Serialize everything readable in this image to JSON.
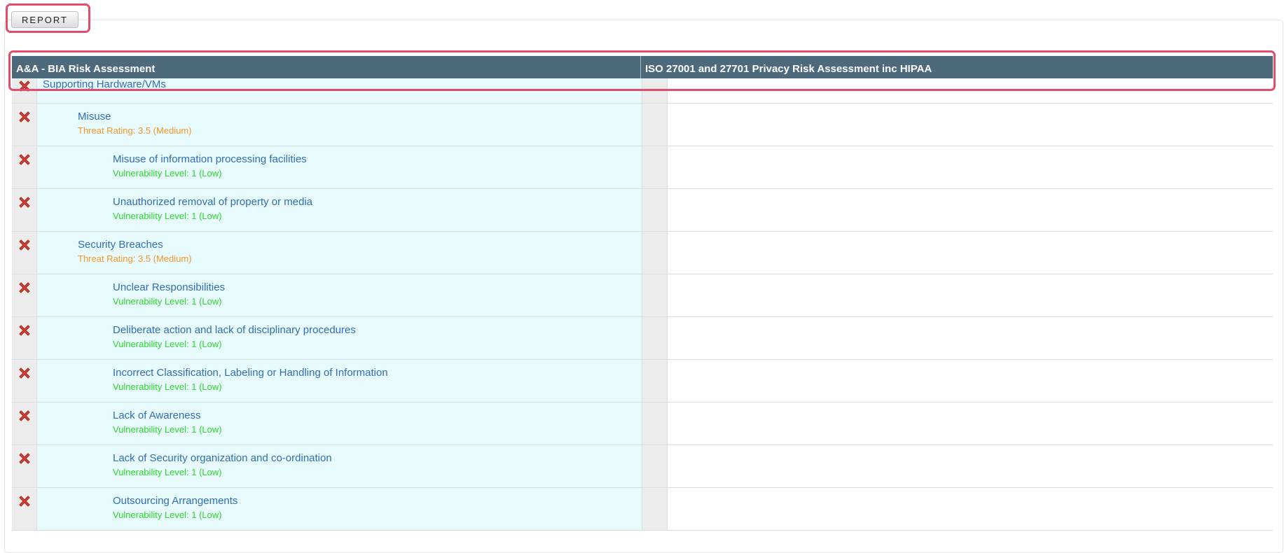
{
  "report_tab": {
    "label": "REPORT"
  },
  "columns": [
    {
      "label": "A&A - BIA Risk Assessment"
    },
    {
      "label": "ISO 27001 and 27701 Privacy Risk Assessment inc HIPAA"
    }
  ],
  "rows": [
    {
      "title": "Supporting Hardware/VMs",
      "subtitle": "",
      "type": "asset"
    },
    {
      "title": "Misuse",
      "subtitle": "Threat Rating: 3.5 (Medium)",
      "type": "threat"
    },
    {
      "title": "Misuse of information processing facilities",
      "subtitle": "Vulnerability Level: 1 (Low)",
      "type": "vulnerability"
    },
    {
      "title": "Unauthorized removal of property or media",
      "subtitle": "Vulnerability Level: 1 (Low)",
      "type": "vulnerability"
    },
    {
      "title": "Security Breaches",
      "subtitle": "Threat Rating: 3.5 (Medium)",
      "type": "threat"
    },
    {
      "title": "Unclear Responsibilities",
      "subtitle": "Vulnerability Level: 1 (Low)",
      "type": "vulnerability"
    },
    {
      "title": "Deliberate action and lack of disciplinary procedures",
      "subtitle": "Vulnerability Level: 1 (Low)",
      "type": "vulnerability"
    },
    {
      "title": "Incorrect Classification, Labeling or Handling of Information",
      "subtitle": "Vulnerability Level: 1 (Low)",
      "type": "vulnerability"
    },
    {
      "title": "Lack of Awareness",
      "subtitle": "Vulnerability Level: 1 (Low)",
      "type": "vulnerability"
    },
    {
      "title": "Lack of Security organization and co-ordination",
      "subtitle": "Vulnerability Level: 1 (Low)",
      "type": "vulnerability"
    },
    {
      "title": "Outsourcing Arrangements",
      "subtitle": "Vulnerability Level: 1 (Low)",
      "type": "vulnerability"
    }
  ],
  "colors": {
    "header_bg": "#4d6a7c",
    "title_link": "#2f6db4",
    "threat_text": "#f2962a",
    "vulnerability_text": "#2bd82b",
    "highlight": "#e14d6b",
    "row_bg": "#e8fbfc"
  },
  "icons": {
    "remove": "close-x-icon"
  }
}
